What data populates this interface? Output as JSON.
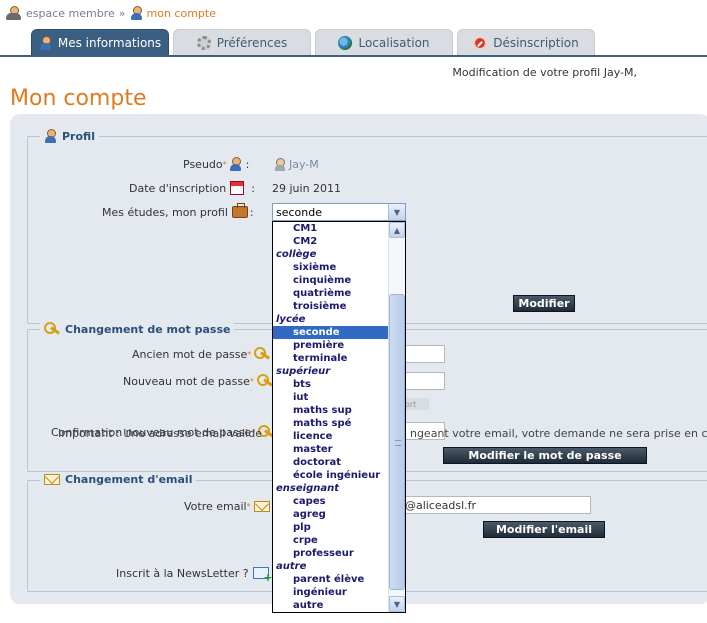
{
  "breadcrumb": {
    "home": "espace membre",
    "separator": "»",
    "current": "mon compte"
  },
  "tabs": [
    {
      "label": "Mes informations",
      "icon": "user-icon",
      "active": true
    },
    {
      "label": "Préférences",
      "icon": "gear-icon",
      "active": false
    },
    {
      "label": "Localisation",
      "icon": "globe-icon",
      "active": false
    },
    {
      "label": "Désinscription",
      "icon": "stop-icon",
      "active": false
    }
  ],
  "profile_message": "Modification de votre profil Jay-M,",
  "page_title": "Mon compte",
  "profil": {
    "legend": "Profil",
    "pseudo_label": "Pseudo",
    "pseudo_value": "Jay-M",
    "date_label": "Date d'inscription",
    "date_value": "29 juin 2011",
    "etudes_label": "Mes études, mon profil",
    "colon": ":",
    "selected": "seconde",
    "button": "Modifier"
  },
  "password": {
    "legend": "Changement de mot passe",
    "old_label": "Ancien mot de passe",
    "new_label": "Nouveau mot de passe",
    "confirm_label": "Confirmation nouveau mot de passe",
    "strength_text": "ort",
    "button": "Modifier le mot de passe"
  },
  "email": {
    "legend": "Changement d'email",
    "label": "Votre email",
    "value_visible": "@aliceadsl.fr",
    "button": "Modifier l'email",
    "important_left": "Important : Une adresse email valide",
    "important_right": "ngeant votre email, votre demande ne sera prise en co",
    "newsletter_label": "Inscrit à la NewsLetter ?"
  },
  "dropdown_options": [
    {
      "type": "item",
      "label": "CM1"
    },
    {
      "type": "item",
      "label": "CM2"
    },
    {
      "type": "group",
      "label": "collège"
    },
    {
      "type": "item",
      "label": "sixième"
    },
    {
      "type": "item",
      "label": "cinquième"
    },
    {
      "type": "item",
      "label": "quatrième"
    },
    {
      "type": "item",
      "label": "troisième"
    },
    {
      "type": "group",
      "label": "lycée"
    },
    {
      "type": "item",
      "label": "seconde",
      "selected": true
    },
    {
      "type": "item",
      "label": "première"
    },
    {
      "type": "item",
      "label": "terminale"
    },
    {
      "type": "group",
      "label": "supérieur"
    },
    {
      "type": "item",
      "label": "bts"
    },
    {
      "type": "item",
      "label": "iut"
    },
    {
      "type": "item",
      "label": "maths sup"
    },
    {
      "type": "item",
      "label": "maths spé"
    },
    {
      "type": "item",
      "label": "licence"
    },
    {
      "type": "item",
      "label": "master"
    },
    {
      "type": "item",
      "label": "doctorat"
    },
    {
      "type": "item",
      "label": "école ingénieur"
    },
    {
      "type": "group",
      "label": "enseignant"
    },
    {
      "type": "item",
      "label": "capes"
    },
    {
      "type": "item",
      "label": "agreg"
    },
    {
      "type": "item",
      "label": "plp"
    },
    {
      "type": "item",
      "label": "crpe"
    },
    {
      "type": "item",
      "label": "professeur"
    },
    {
      "type": "group",
      "label": "autre"
    },
    {
      "type": "item",
      "label": "parent élève"
    },
    {
      "type": "item",
      "label": "ingénieur"
    },
    {
      "type": "item",
      "label": "autre"
    }
  ],
  "colors": {
    "accent": "#e07a1f",
    "tab_active": "#3b5f82",
    "panel": "#e3e9ef",
    "legend": "#2b4f7c",
    "selection": "#316ac5"
  }
}
